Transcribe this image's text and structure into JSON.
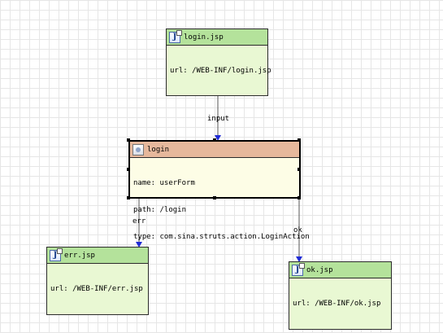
{
  "nodes": {
    "login_jsp": {
      "title": "login.jsp",
      "url": "url: /WEB-INF/login.jsp",
      "icon": "jsp-file-icon"
    },
    "login_action": {
      "title": "login",
      "name": "name: userForm",
      "path": "path: /login",
      "type": "type: com.sina.struts.action.LoginAction",
      "icon": "struts-action-icon"
    },
    "err_jsp": {
      "title": "err.jsp",
      "url": "url: /WEB-INF/err.jsp",
      "icon": "jsp-file-icon"
    },
    "ok_jsp": {
      "title": "ok.jsp",
      "url": "url: /WEB-INF/ok.jsp",
      "icon": "jsp-file-icon"
    }
  },
  "edges": {
    "input": "input",
    "err": "err",
    "ok": "ok"
  },
  "colors": {
    "jsp_header": "#b4e29b",
    "jsp_body": "#e9f8d3",
    "action_header": "#e6b89c",
    "action_body": "#fdfde6",
    "arrow": "#1f2bd6"
  }
}
